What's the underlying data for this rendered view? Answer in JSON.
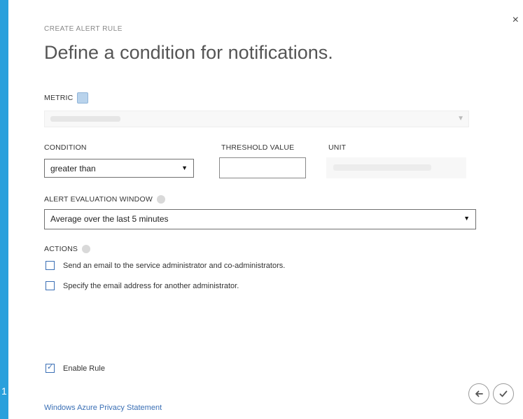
{
  "dialog": {
    "eyebrow": "CREATE ALERT RULE",
    "title": "Define a condition for notifications.",
    "close_icon": "×",
    "step_number": "1"
  },
  "metric": {
    "label": "METRIC",
    "value": ""
  },
  "condition": {
    "label": "CONDITION",
    "selected": "greater than"
  },
  "threshold": {
    "label": "THRESHOLD VALUE",
    "value": ""
  },
  "unit": {
    "label": "UNIT",
    "value": ""
  },
  "evaluation": {
    "label": "ALERT EVALUATION WINDOW",
    "selected": "Average over the last 5 minutes"
  },
  "actions": {
    "label": "ACTIONS",
    "items": [
      {
        "label": "Send an email to the service administrator and co-administrators.",
        "checked": false
      },
      {
        "label": "Specify the email address for another administrator.",
        "checked": false
      }
    ]
  },
  "enable_rule": {
    "label": "Enable Rule",
    "checked": true
  },
  "footer": {
    "privacy_link": "Windows Azure Privacy Statement"
  },
  "colors": {
    "accent": "#2aa0dc",
    "link": "#3a6fb5"
  }
}
